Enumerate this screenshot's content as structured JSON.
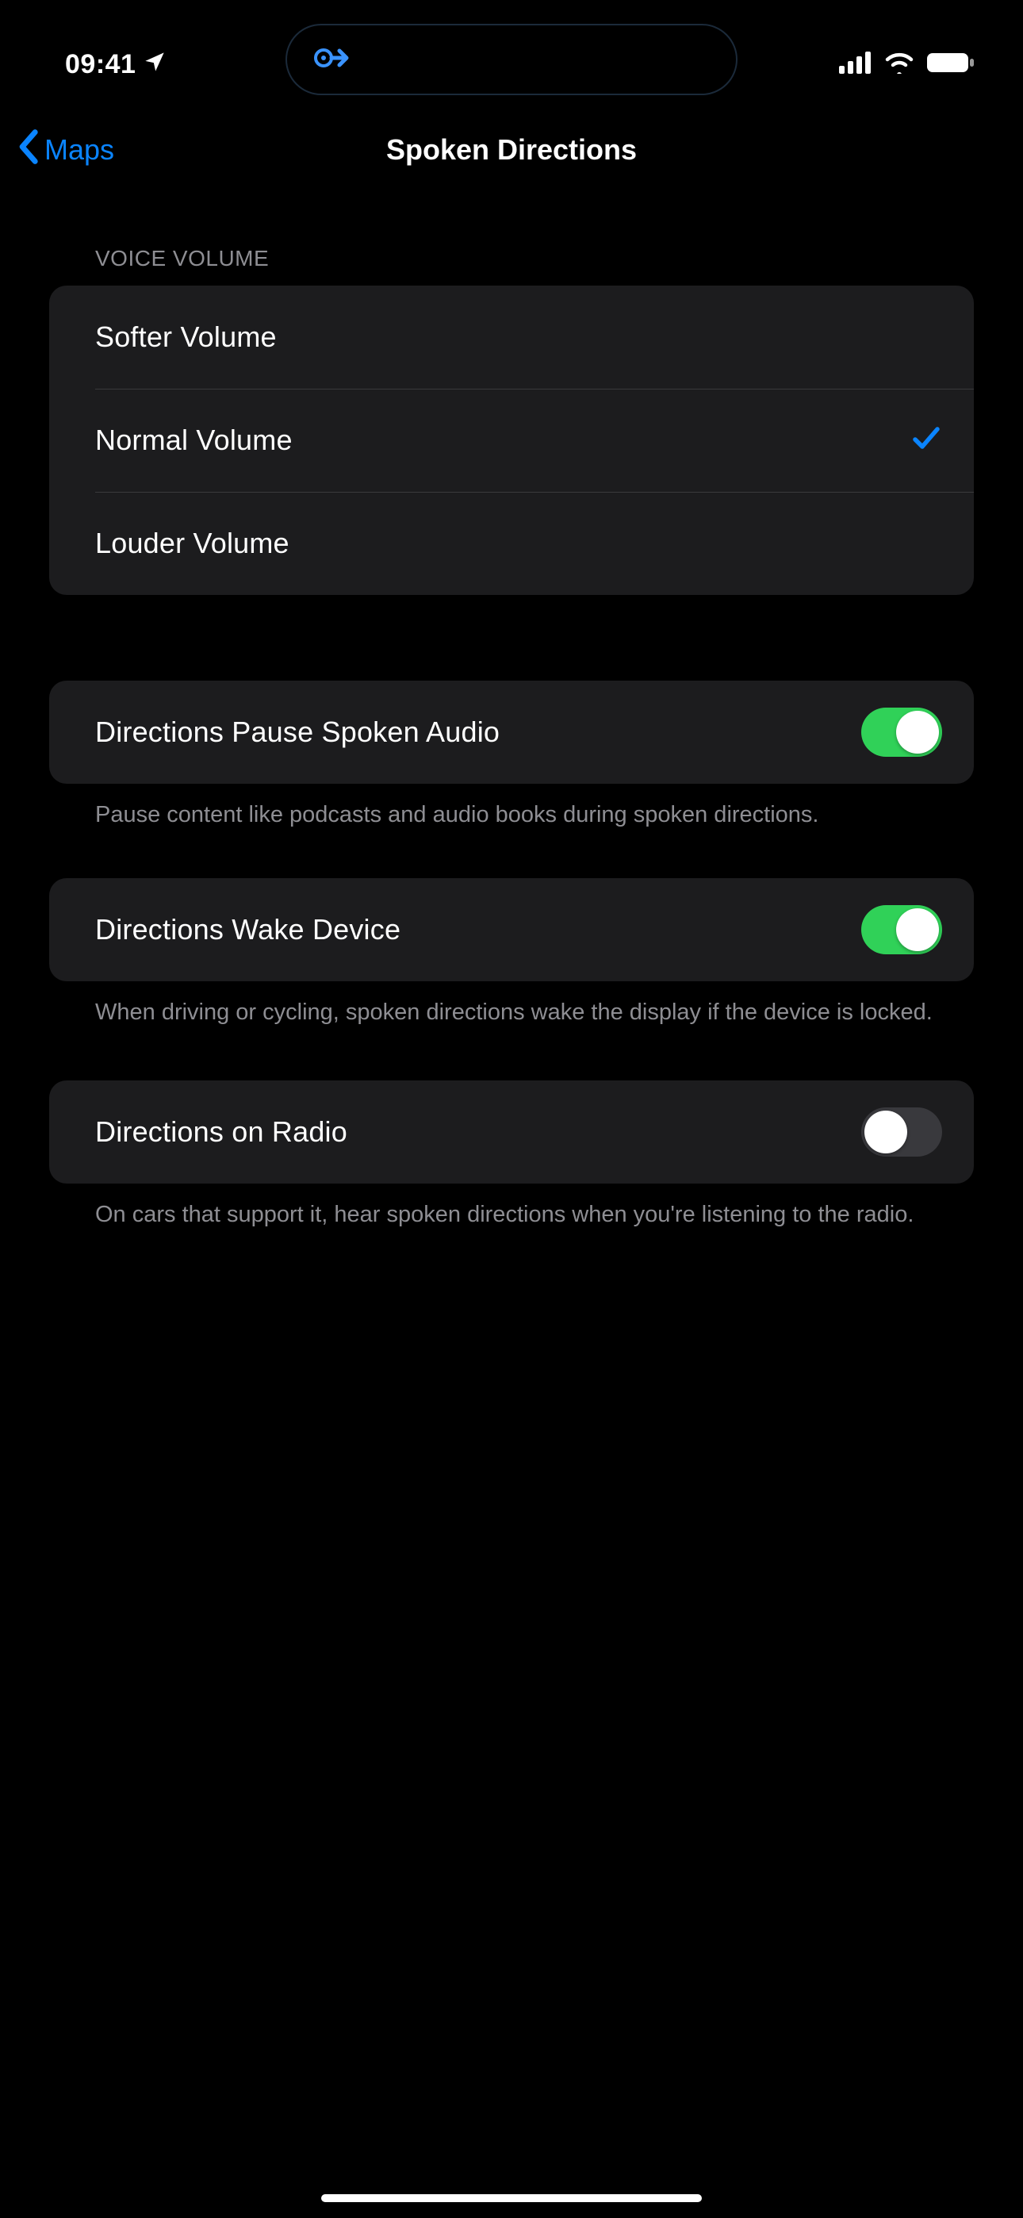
{
  "statusBar": {
    "time": "09:41"
  },
  "dynamicIsland": {},
  "nav": {
    "backLabel": "Maps",
    "title": "Spoken Directions"
  },
  "sections": {
    "voiceVolume": {
      "header": "Voice Volume",
      "items": [
        {
          "label": "Softer Volume",
          "selected": false
        },
        {
          "label": "Normal Volume",
          "selected": true
        },
        {
          "label": "Louder Volume",
          "selected": false
        }
      ]
    },
    "pauseAudio": {
      "label": "Directions Pause Spoken Audio",
      "on": true,
      "footer": "Pause content like podcasts and audio books during spoken directions."
    },
    "wakeDevice": {
      "label": "Directions Wake Device",
      "on": true,
      "footer": "When driving or cycling, spoken directions wake the display if the device is locked."
    },
    "onRadio": {
      "label": "Directions on Radio",
      "on": false,
      "footer": "On cars that support it, hear spoken directions when you're listening to the radio."
    }
  }
}
